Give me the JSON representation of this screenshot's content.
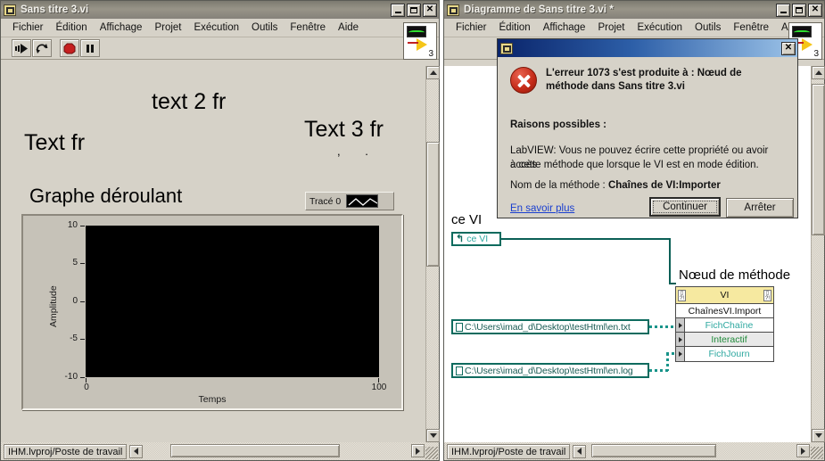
{
  "front_panel": {
    "title": "Sans titre 3.vi",
    "window_buttons": {
      "minimize": "_",
      "maximize": "□",
      "close": "✕"
    },
    "menu": [
      "Fichier",
      "Édition",
      "Affichage",
      "Projet",
      "Exécution",
      "Outils",
      "Fenêtre",
      "Aide"
    ],
    "toolbar": {
      "run": "run-arrow-icon",
      "run_continuously": "run-continuously-icon",
      "abort": "abort-execution-icon",
      "pause": "pause-icon",
      "help": "?",
      "vi_icon_number": "3"
    },
    "labels": {
      "text1": "Text fr",
      "text2": "text 2 fr",
      "text3": "Text 3 fr",
      "graph_title": "Graphe déroulant"
    },
    "legend": {
      "plot_name": "Tracé 0"
    },
    "status": "IHM.lvproj/Poste de travail"
  },
  "block_diagram": {
    "title": "Diagramme de Sans titre 3.vi *",
    "window_buttons": {
      "minimize": "_",
      "maximize": "□",
      "close": "✕"
    },
    "menu": [
      "Fichier",
      "Édition",
      "Affichage",
      "Projet",
      "Exécution",
      "Outils",
      "Fenêtre",
      "Aide"
    ],
    "toolbar": {
      "vi_icon_number": "3"
    },
    "this_vi": {
      "label": "ce VI",
      "terminal_text": "ce VI",
      "icon": "vi-reference-icon"
    },
    "method_node": {
      "caption": "Nœud de méthode",
      "header_type": "VI",
      "class_name": "ChaînesVI.Import",
      "parameters": [
        {
          "name": "FichChaîne",
          "color": "#2ea8a0"
        },
        {
          "name": "Interactif",
          "color": "#1f8a3a"
        },
        {
          "name": "FichJourn",
          "color": "#2ea8a0"
        }
      ]
    },
    "path_constants": [
      "C:\\Users\\imad_d\\Desktop\\testHtml\\en.txt",
      "C:\\Users\\imad_d\\Desktop\\testHtml\\en.log"
    ],
    "status": "IHM.lvproj/Poste de travail"
  },
  "error_dialog": {
    "title": "",
    "close_label": "✕",
    "icon": "error-cross-icon",
    "heading_line1": "L'erreur 1073 s'est produite à : Nœud de",
    "heading_line2": "méthode dans Sans titre 3.vi",
    "reasons_heading": "Raisons possibles :",
    "body_line1": "LabVIEW:  Vous ne pouvez écrire cette propriété ou avoir accès",
    "body_line2": "à cette méthode que lorsque le VI est en mode édition.",
    "method_label": "Nom de la méthode : ",
    "method_value": "Chaînes de VI:Importer",
    "link": "En savoir plus",
    "continue_button": "Continuer",
    "stop_button": "Arrêter"
  },
  "chart_data": {
    "type": "line",
    "title": "Graphe déroulant",
    "xlabel": "Temps",
    "ylabel": "Amplitude",
    "xlim": [
      0,
      100
    ],
    "ylim": [
      -10,
      10
    ],
    "x_ticks": [
      "0",
      "100"
    ],
    "y_ticks": [
      "10",
      "5",
      "0",
      "-5",
      "-10"
    ],
    "grid": false,
    "legend_position": "top-right",
    "series": [
      {
        "name": "Tracé 0",
        "color": "#ffffff",
        "values": []
      }
    ],
    "plot_background": "#000000"
  }
}
